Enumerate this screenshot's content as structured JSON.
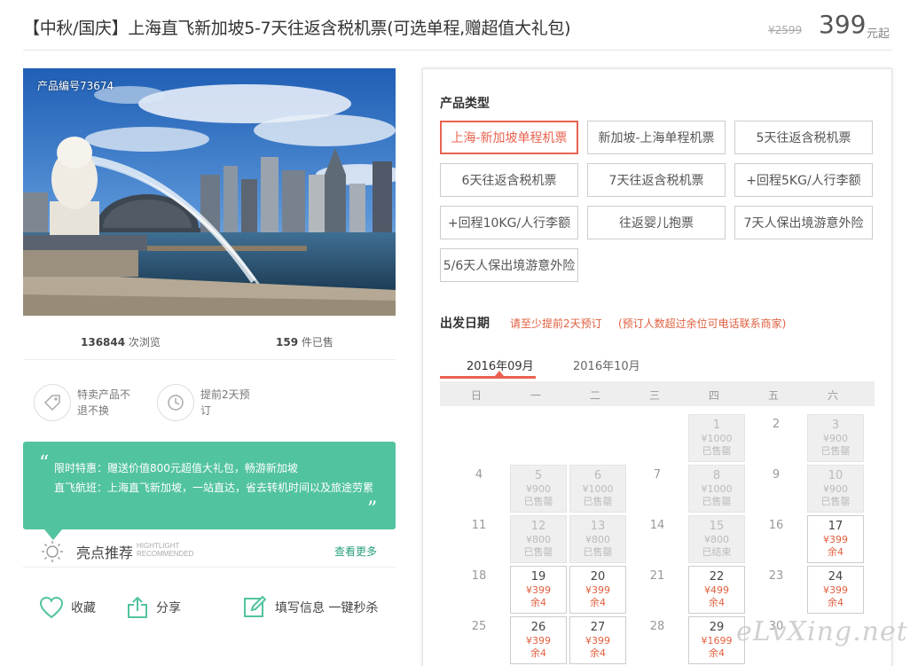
{
  "header": {
    "title": "【中秋/国庆】上海直飞新加坡5-7天往返含税机票(可选单程,赠超值大礼包)",
    "old_price": "¥2599",
    "price": "399",
    "price_unit": "元起"
  },
  "product": {
    "id_label": "产品编号73674",
    "views_count": "136844",
    "views_label": " 次浏览",
    "sold_count": "159",
    "sold_label": " 件已售"
  },
  "features": [
    {
      "icon": "tag-icon",
      "text": "特卖产品不退不换"
    },
    {
      "icon": "clock-icon",
      "text": "提前2天预订"
    }
  ],
  "promo": {
    "line1": "限时特惠：赠送价值800元超值大礼包，畅游新加坡",
    "line2": "直飞航班：上海直飞新加坡，一站直达，省去转机时间以及旅途劳累"
  },
  "highlights": {
    "title": "亮点推荐",
    "en_line1": "HIGHTLIGHT",
    "en_line2": "RECOMMENDED",
    "more_link": "查看更多"
  },
  "actions": {
    "favorite": "收藏",
    "share": "分享",
    "book": "填写信息 一键秒杀"
  },
  "product_types": {
    "title": "产品类型",
    "items": [
      "上海-新加坡单程机票",
      "新加坡-上海单程机票",
      "5天往返含税机票",
      "6天往返含税机票",
      "7天往返含税机票",
      "+回程5KG/人行李额",
      "+回程10KG/人行李额",
      "往返婴儿抱票",
      "7天人保出境游意外险",
      "5/6天人保出境游意外险"
    ],
    "selected_index": 0
  },
  "departure": {
    "title": "出发日期",
    "note1": "请至少提前2天预订",
    "note2": "(预订人数超过余位可电话联系商家)"
  },
  "calendar": {
    "months": [
      "2016年09月",
      "2016年10月"
    ],
    "weekdays": [
      "日",
      "一",
      "二",
      "三",
      "四",
      "五",
      "六"
    ],
    "days": [
      {
        "d": "1",
        "price": "¥1000",
        "status": "已售罄"
      },
      {
        "d": "2"
      },
      {
        "d": "3",
        "price": "¥900",
        "status": "已售罄"
      },
      {
        "d": "4"
      },
      {
        "d": "5",
        "price": "¥900",
        "status": "已售罄"
      },
      {
        "d": "6",
        "price": "¥1000",
        "status": "已售罄"
      },
      {
        "d": "7"
      },
      {
        "d": "8",
        "price": "¥1000",
        "status": "已售罄"
      },
      {
        "d": "9"
      },
      {
        "d": "10",
        "price": "¥900",
        "status": "已售罄"
      },
      {
        "d": "11"
      },
      {
        "d": "12",
        "price": "¥800",
        "status": "已售罄"
      },
      {
        "d": "13",
        "price": "¥800",
        "status": "已售罄"
      },
      {
        "d": "14"
      },
      {
        "d": "15",
        "price": "¥800",
        "status": "已结束"
      },
      {
        "d": "16"
      },
      {
        "d": "17",
        "price": "¥399",
        "status": "余4",
        "available": true
      },
      {
        "d": "18"
      },
      {
        "d": "19",
        "price": "¥399",
        "status": "余4",
        "available": true
      },
      {
        "d": "20",
        "price": "¥399",
        "status": "余4",
        "available": true
      },
      {
        "d": "21"
      },
      {
        "d": "22",
        "price": "¥499",
        "status": "余4",
        "available": true
      },
      {
        "d": "23"
      },
      {
        "d": "24",
        "price": "¥399",
        "status": "余4",
        "available": true
      },
      {
        "d": "25"
      },
      {
        "d": "26",
        "price": "¥399",
        "status": "余4",
        "available": true
      },
      {
        "d": "27",
        "price": "¥399",
        "status": "余4",
        "available": true
      },
      {
        "d": "28"
      },
      {
        "d": "29",
        "price": "¥1699",
        "status": "余4",
        "available": true
      },
      {
        "d": "30"
      }
    ]
  },
  "watermark": "eLvXing.net"
}
